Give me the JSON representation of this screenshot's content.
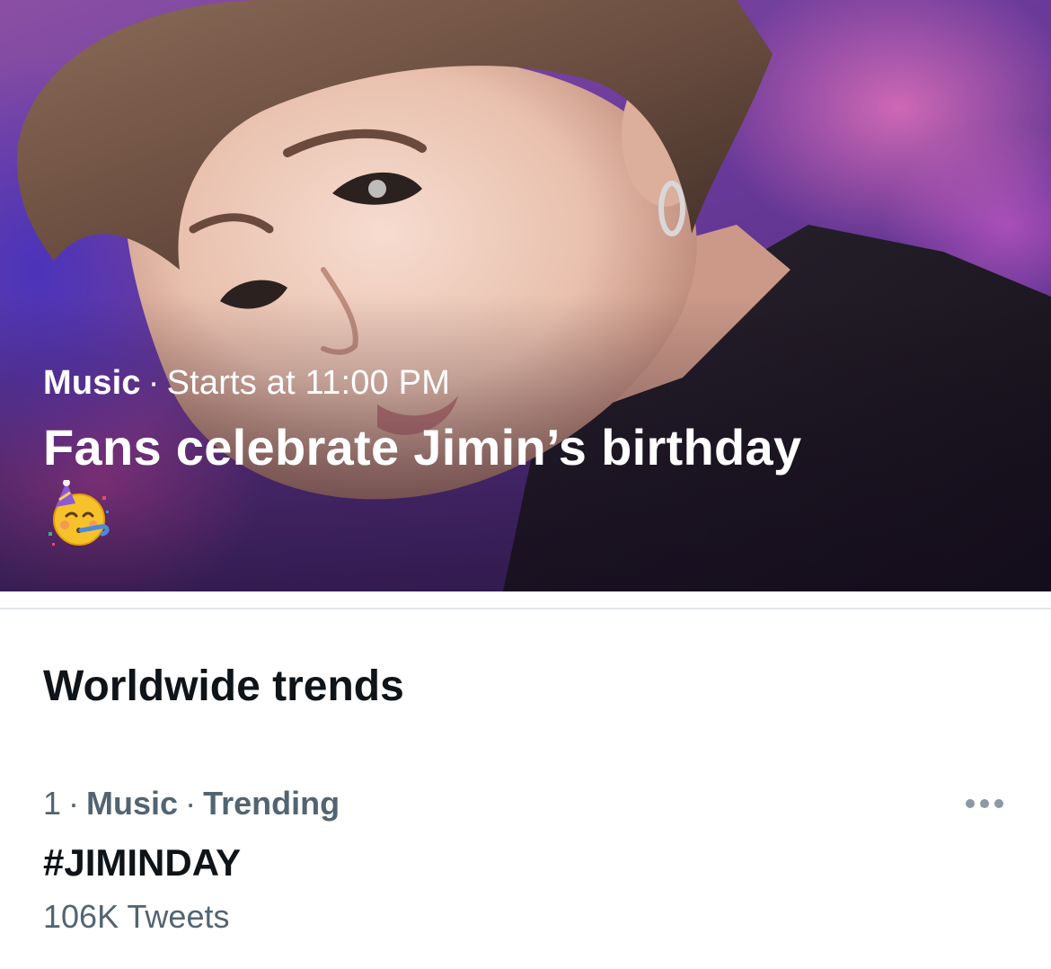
{
  "hero": {
    "category": "Music",
    "separator": "·",
    "status": "Starts at 11:00 PM",
    "title": "Fans celebrate Jimin’s birthday",
    "emoji_icon": "partying-face-icon",
    "image_icon": "person-photo"
  },
  "trends": {
    "section_title": "Worldwide trends",
    "items": [
      {
        "rank": "1",
        "category": "Music",
        "status": "Trending",
        "separator": "·",
        "name": "#JIMINDAY",
        "count": "106K Tweets",
        "more_icon": "more-horizontal-icon"
      }
    ]
  },
  "colors": {
    "primary_text": "#0f1419",
    "secondary_text": "#536471",
    "divider": "#e1e6ea",
    "background": "#ffffff"
  }
}
